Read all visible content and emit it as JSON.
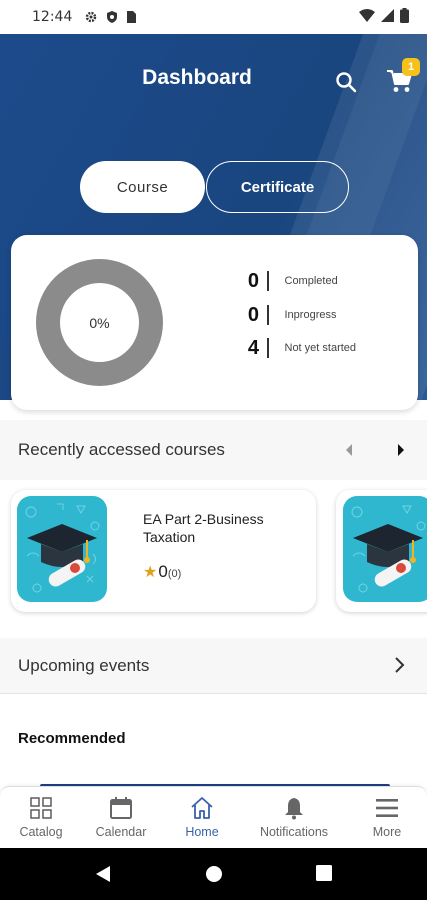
{
  "status_bar": {
    "time": "12:44"
  },
  "header": {
    "title": "Dashboard",
    "cart_count": "1"
  },
  "tabs": {
    "course": "Course",
    "certificate": "Certificate"
  },
  "summary": {
    "progress_text": "0%",
    "stats": [
      {
        "value": "0",
        "label": "Completed"
      },
      {
        "value": "0",
        "label": "Inprogress"
      },
      {
        "value": "4",
        "label": "Not yet started"
      }
    ]
  },
  "recent": {
    "title": "Recently accessed courses",
    "courses": [
      {
        "title": "EA Part 2-Business Taxation",
        "rating": "0",
        "rating_count": "(0)"
      }
    ]
  },
  "upcoming": {
    "title": "Upcoming events"
  },
  "recommended": {
    "title": "Recommended"
  },
  "bottom_nav": {
    "items": [
      {
        "label": "Catalog",
        "icon": "grid-icon"
      },
      {
        "label": "Calendar",
        "icon": "calendar-icon"
      },
      {
        "label": "Home",
        "icon": "home-icon"
      },
      {
        "label": "Notifications",
        "icon": "bell-icon"
      },
      {
        "label": "More",
        "icon": "menu-icon"
      }
    ],
    "active": "Home"
  },
  "colors": {
    "header_blue": "#1c4a8b",
    "badge_yellow": "#f4c21b",
    "active_nav": "#3b62a8",
    "donut_gray": "#8b8b8b",
    "thumb_cyan": "#2fb7cf"
  }
}
